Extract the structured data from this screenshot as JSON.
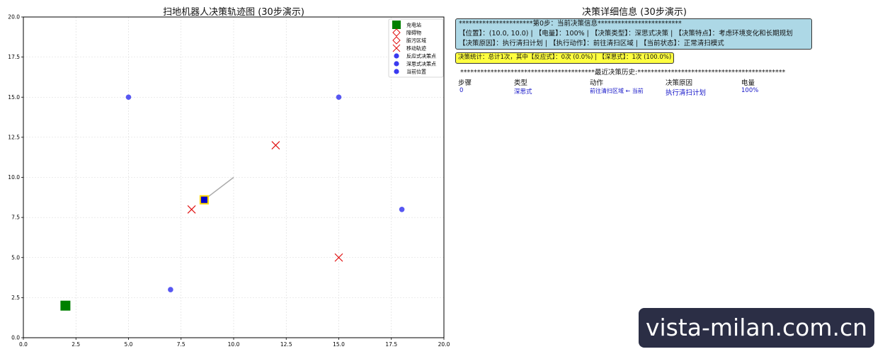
{
  "chart_data": {
    "type": "scatter",
    "title": "扫地机器人决策轨迹图 (30步演示)",
    "xlim": [
      0,
      20
    ],
    "ylim": [
      0,
      20
    ],
    "xticks": [
      "0.0",
      "2.5",
      "5.0",
      "7.5",
      "10.0",
      "12.5",
      "15.0",
      "17.5",
      "20.0"
    ],
    "yticks": [
      "0.0",
      "2.5",
      "5.0",
      "7.5",
      "10.0",
      "12.5",
      "15.0",
      "17.5",
      "20.0"
    ],
    "grid": true,
    "legend_position": "top-right",
    "legend": [
      "充电站",
      "障碍物",
      "脏污区域",
      "移动轨迹",
      "反应式决策点",
      "深思式决策点",
      "当前位置"
    ],
    "charging_station": {
      "x": 2,
      "y": 2,
      "color": "#008000"
    },
    "obstacles": [],
    "dirty_areas": [
      {
        "x": 8,
        "y": 8
      },
      {
        "x": 12,
        "y": 12
      },
      {
        "x": 15,
        "y": 5
      }
    ],
    "dirty_color": "#e01010",
    "decision_points": [
      {
        "x": 5,
        "y": 15
      },
      {
        "x": 15,
        "y": 15
      },
      {
        "x": 7,
        "y": 3
      },
      {
        "x": 18,
        "y": 8
      }
    ],
    "decision_color": "#3a3af0",
    "trajectory": [
      {
        "x": 10,
        "y": 10
      },
      {
        "x": 8.6,
        "y": 8.6
      }
    ],
    "trajectory_color": "#aaaaaa",
    "current_position": {
      "x": 8.6,
      "y": 8.6,
      "color": "#0000cc",
      "edge": "#ffd700"
    }
  },
  "right_panel": {
    "title": "决策详细信息 (30步演示)",
    "info_lines": [
      "**********************第0步：当前决策信息*************************",
      "【位置】：(10.0, 10.0) | 【电量】：100% | 【决策类型】：深思式决策 | 【决策特点】：考虑环境变化和长期规划",
      "【决策原因】：执行清扫计划 | 【执行动作】：前往清扫区域 | 【当前状态】：正常清扫模式"
    ],
    "stats": "决策统计：总计1次，其中【反应式】：0次 (0.0%) | 【深思式】：1次 (100.0%)",
    "history_title": "****************************************最近决策历史:********************************************",
    "history_columns": [
      "步骤",
      "类型",
      "动作",
      "决策原因",
      "电量"
    ],
    "history_rows": [
      {
        "step": "0",
        "type": "深思式",
        "action": "前往清扫区域 ← 当前",
        "reason": "执行清扫计划",
        "battery": "100%"
      }
    ]
  },
  "watermark": "vista-milan.com.cn"
}
